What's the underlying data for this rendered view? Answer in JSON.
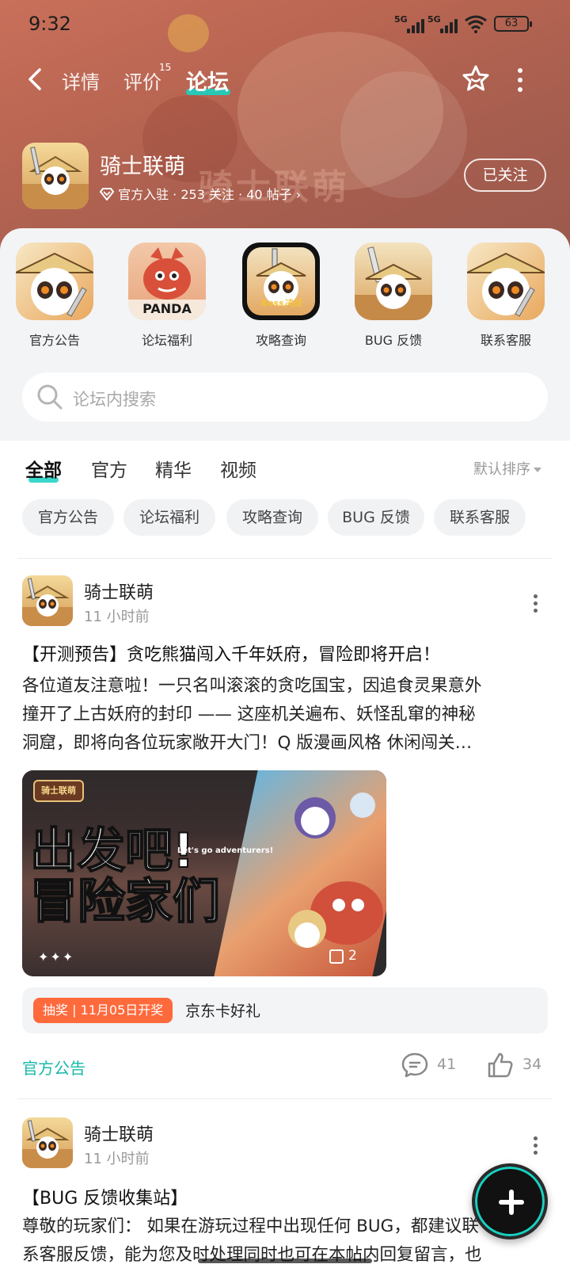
{
  "status_bar": {
    "time": "9:32",
    "network_1": "5G",
    "network_2": "5G",
    "battery": "63"
  },
  "nav": {
    "tabs": [
      {
        "label": "详情"
      },
      {
        "label": "评价",
        "badge": "15"
      },
      {
        "label": "论坛",
        "active": true
      }
    ],
    "icons": [
      "back-icon",
      "star-outline-icon",
      "more-vertical-icon"
    ]
  },
  "game": {
    "name": "骑士联萌",
    "meta": "官方入驻 · 253 关注 · 40 帖子",
    "follow_label": "已关注",
    "banner_text": "骑士联萌"
  },
  "categories": [
    {
      "label": "官方公告",
      "overlay": ""
    },
    {
      "label": "论坛福利",
      "overlay": "PANDA"
    },
    {
      "label": "攻略查询",
      "overlay": "Boss决战"
    },
    {
      "label": "BUG 反馈",
      "overlay": ""
    },
    {
      "label": "联系客服",
      "overlay": ""
    }
  ],
  "search": {
    "placeholder": "论坛内搜索"
  },
  "feed_tabs": [
    {
      "label": "全部",
      "active": true
    },
    {
      "label": "官方"
    },
    {
      "label": "精华"
    },
    {
      "label": "视频"
    }
  ],
  "sort_label": "默认排序",
  "chips": [
    "官方公告",
    "论坛福利",
    "攻略查询",
    "BUG 反馈",
    "联系客服"
  ],
  "posts": [
    {
      "author": "骑士联萌",
      "time": "11 小时前",
      "title": "【开测预告】贪吃熊猫闯入千年妖府，冒险即将开启！",
      "body_lines": [
        "各位道友注意啦！一只名叫滚滚的贪吃国宝，因追食灵果意外",
        "撞开了上古妖府的封印 —— 这座机关遍布、妖怪乱窜的神秘",
        "洞窟，即将向各位玩家敞开大门！Q 版漫画风格 休闲闯关…"
      ],
      "image": {
        "logo": "骑士联萌",
        "headline_1": "出发吧!",
        "headline_2": "冒险家们",
        "subline": "Let's go adventurers!",
        "stars": "✦✦✦",
        "image_count": "2"
      },
      "lottery": {
        "tag": "抽奖 | 11月05日开奖",
        "text": "京东卡好礼"
      },
      "category": "官方公告",
      "comments": "41",
      "likes": "34"
    },
    {
      "author": "骑士联萌",
      "time": "11 小时前",
      "title": "【BUG 反馈收集站】",
      "body_lines": [
        "尊敬的玩家们：  如果在游玩过程中出现任何 BUG，都建议联",
        "系客服反馈，能为您及时处理同时也可在本帖内回复留言，也"
      ]
    }
  ],
  "colors": {
    "accent": "#18d1c1",
    "lottery_tag": "#ff6a3d",
    "category_link": "#17b8aa"
  }
}
